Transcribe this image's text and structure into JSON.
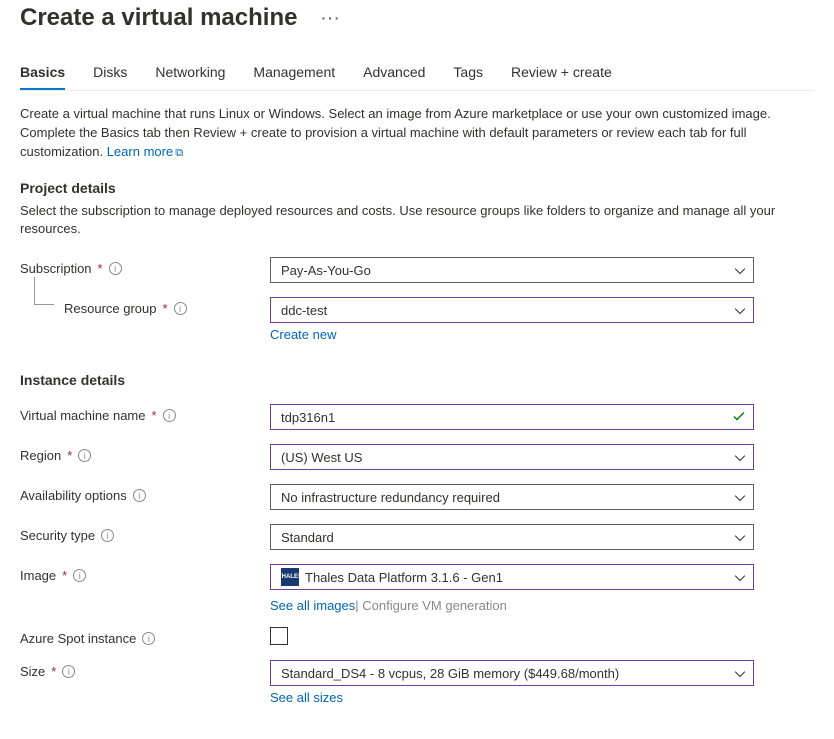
{
  "header": {
    "title": "Create a virtual machine"
  },
  "tabs": [
    {
      "label": "Basics",
      "active": true
    },
    {
      "label": "Disks"
    },
    {
      "label": "Networking"
    },
    {
      "label": "Management"
    },
    {
      "label": "Advanced"
    },
    {
      "label": "Tags"
    },
    {
      "label": "Review + create"
    }
  ],
  "intro_text": "Create a virtual machine that runs Linux or Windows. Select an image from Azure marketplace or use your own customized image. Complete the Basics tab then Review + create to provision a virtual machine with default parameters or review each tab for full customization. ",
  "learn_more": "Learn more",
  "sections": {
    "project": {
      "heading": "Project details",
      "desc": "Select the subscription to manage deployed resources and costs. Use resource groups like folders to organize and manage all your resources.",
      "subscription_label": "Subscription",
      "subscription_value": "Pay-As-You-Go",
      "rg_label": "Resource group",
      "rg_value": "ddc-test",
      "create_new": "Create new"
    },
    "instance": {
      "heading": "Instance details",
      "vmname_label": "Virtual machine name",
      "vmname_value": "tdp316n1",
      "region_label": "Region",
      "region_value": "(US) West US",
      "avail_label": "Availability options",
      "avail_value": "No infrastructure redundancy required",
      "security_label": "Security type",
      "security_value": "Standard",
      "image_label": "Image",
      "image_value": "Thales Data Platform 3.1.6 - Gen1",
      "see_all_images": "See all images",
      "configure_gen": "Configure VM generation",
      "spot_label": "Azure Spot instance",
      "size_label": "Size",
      "size_value": "Standard_DS4 - 8 vcpus, 28 GiB memory ($449.68/month)",
      "see_all_sizes": "See all sizes"
    }
  }
}
